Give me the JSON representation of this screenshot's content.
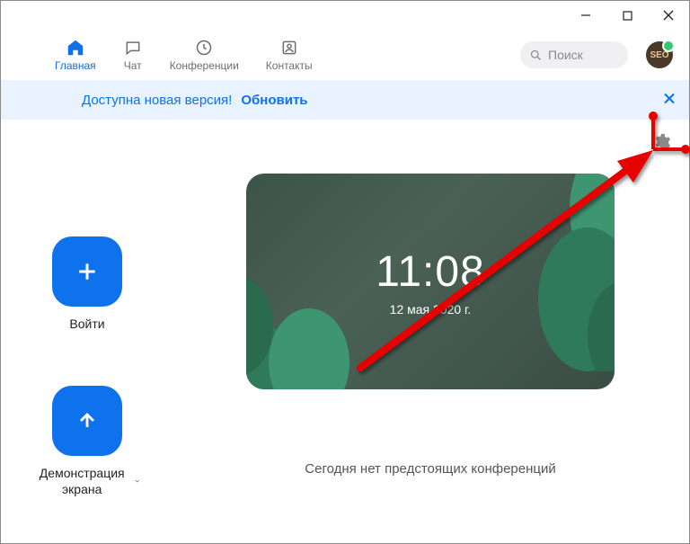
{
  "nav": {
    "home": "Главная",
    "chat": "Чат",
    "meetings": "Конференции",
    "contacts": "Контакты"
  },
  "search": {
    "placeholder": "Поиск"
  },
  "banner": {
    "text": "Доступна новая версия!",
    "link": "Обновить"
  },
  "actions": {
    "join": "Войти",
    "share": "Демонстрация экрана"
  },
  "clock": {
    "time": "11:08",
    "date": "12 мая 2020 г."
  },
  "empty_meetings": "Сегодня нет предстоящих конференций"
}
